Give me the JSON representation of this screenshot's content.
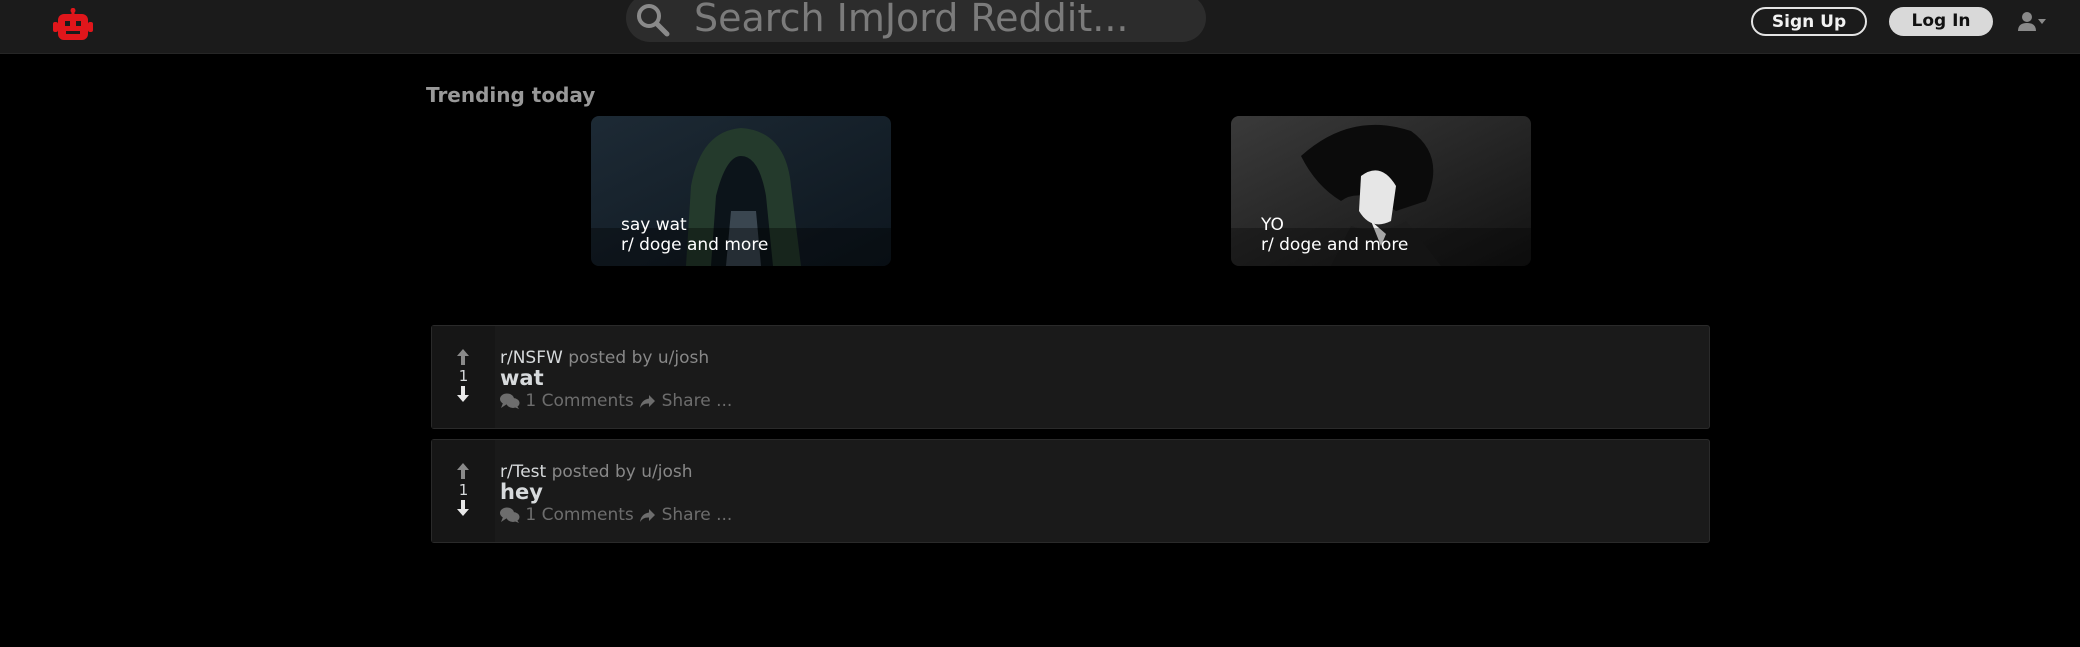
{
  "header": {
    "logo_icon": "reddit-robot-icon",
    "logo_color": "#e0161b",
    "search_placeholder": "Search ImJord Reddit...",
    "signup_label": "Sign Up",
    "login_label": "Log In",
    "user_menu_icon": "user-dropdown-icon"
  },
  "trending": {
    "title": "Trending today",
    "cards": [
      {
        "title": "say wat",
        "community": "r/ doge and more"
      },
      {
        "title": "YO",
        "community": "r/ doge and more"
      }
    ]
  },
  "posts": [
    {
      "subreddit": "r/NSFW",
      "posted_by": "posted by u/josh",
      "title": "wat",
      "votes": "1",
      "comments": "1 Comments",
      "share": "Share",
      "more": "..."
    },
    {
      "subreddit": "r/Test",
      "posted_by": "posted by u/josh",
      "title": "hey",
      "votes": "1",
      "comments": "1 Comments",
      "share": "Share",
      "more": "..."
    }
  ]
}
